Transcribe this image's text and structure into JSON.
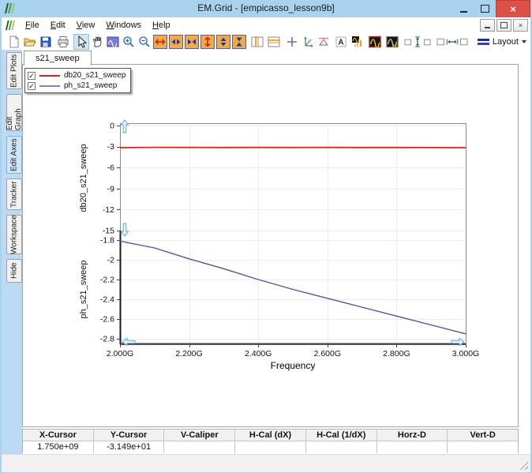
{
  "window": {
    "title": "EM.Grid - [empicasso_lesson9b]"
  },
  "menu": {
    "items": [
      "File",
      "Edit",
      "View",
      "Windows",
      "Help"
    ]
  },
  "toolbar": {
    "layout_label": "Layout",
    "icons": [
      "new-file",
      "open-file",
      "save",
      "print",
      "select-cursor",
      "pan-hand",
      "zoom-region",
      "zoom-in",
      "zoom-out",
      "expand-x-axis",
      "spread-x-axis",
      "compress-x-axis",
      "expand-y-axis",
      "spread-y-axis",
      "compress-y-axis",
      "vertical-bands",
      "horizontal-bands",
      "crosshair",
      "axes-tool",
      "caliper",
      "text-annotation",
      "histogram-view",
      "waveform-view",
      "waveform-alt-view",
      "vertical-spacing",
      "horizontal-spacing",
      "layout-menu"
    ]
  },
  "sidebar": {
    "tabs": [
      {
        "label": "Edit Plots",
        "selected": false
      },
      {
        "label": "Edit Graph",
        "selected": false
      },
      {
        "label": "Edit Axes",
        "selected": true
      },
      {
        "label": "Tracker",
        "selected": false
      },
      {
        "label": "Workspace",
        "selected": false
      },
      {
        "label": "Hide",
        "selected": false
      }
    ]
  },
  "document_tab": {
    "label": "s21_sweep"
  },
  "legend": {
    "entries": [
      {
        "label": "db20_s21_sweep",
        "color": "#e41f1f",
        "checked": true
      },
      {
        "label": "ph_s21_sweep",
        "color": "#8484bc",
        "checked": true
      }
    ]
  },
  "chart_data": {
    "type": "line",
    "xlabel": "Frequency",
    "xlim": [
      2.0,
      3.0
    ],
    "x_ticks": [
      2.0,
      2.2,
      2.4,
      2.6,
      2.8,
      3.0
    ],
    "x_tick_labels": [
      "2.000G",
      "2.200G",
      "2.400G",
      "2.600G",
      "2.800G",
      "3.000G"
    ],
    "grid": true,
    "legend_position": "top-left",
    "panels": [
      {
        "ylabel": "db20_s21_sweep",
        "ylim": [
          -15,
          0
        ],
        "y_ticks": [
          0,
          -3,
          -6,
          -9,
          -12,
          -15
        ],
        "y_tick_labels": [
          "0",
          "-3",
          "-6",
          "-9",
          "-12",
          "-15"
        ],
        "series": {
          "name": "db20_s21_sweep",
          "color": "#e41f1f",
          "x": [
            2.0,
            2.1,
            2.2,
            2.3,
            2.4,
            2.5,
            2.6,
            2.7,
            2.8,
            2.9,
            3.0
          ],
          "y": [
            -3.16,
            -3.11,
            -3.12,
            -3.13,
            -3.12,
            -3.13,
            -3.12,
            -3.13,
            -3.14,
            -3.15,
            -3.16
          ]
        }
      },
      {
        "ylabel": "ph_s21_sweep",
        "ylim": [
          -2.86,
          -1.7
        ],
        "y_ticks": [
          -1.8,
          -2.0,
          -2.2,
          -2.4,
          -2.6,
          -2.8
        ],
        "y_tick_labels": [
          "-1.8",
          "-2",
          "-2.2",
          "-2.4",
          "-2.6",
          "-2.8"
        ],
        "series": {
          "name": "ph_s21_sweep",
          "color": "#5252a5",
          "x": [
            2.0,
            2.1,
            2.2,
            2.3,
            2.4,
            2.5,
            2.6,
            2.7,
            2.8,
            2.9,
            3.0
          ],
          "y": [
            -1.81,
            -1.88,
            -1.99,
            -2.09,
            -2.2,
            -2.3,
            -2.39,
            -2.48,
            -2.57,
            -2.66,
            -2.75
          ]
        }
      }
    ]
  },
  "status_table": {
    "headers": [
      "X-Cursor",
      "Y-Cursor",
      "V-Caliper",
      "H-Cal (dX)",
      "H-Cal (1/dX)",
      "Horz-D",
      "Vert-D"
    ],
    "values": [
      "1.750e+09",
      "-3.149e+01",
      "",
      "",
      "",
      "",
      ""
    ]
  }
}
